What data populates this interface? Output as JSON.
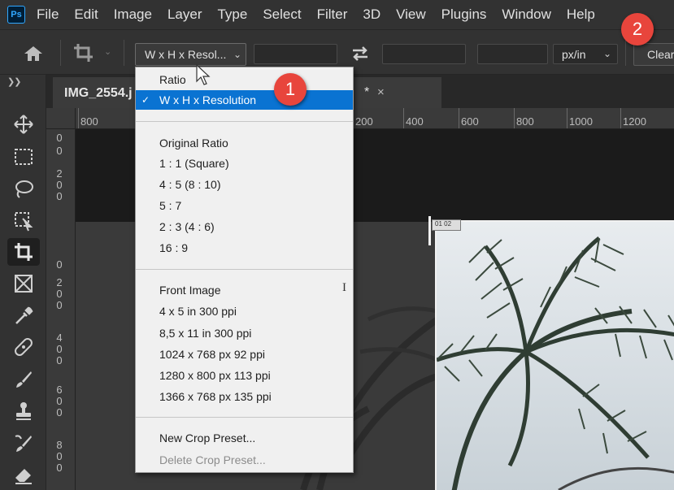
{
  "app": {
    "logo": "Ps"
  },
  "menubar": [
    "File",
    "Edit",
    "Image",
    "Layer",
    "Type",
    "Select",
    "Filter",
    "3D",
    "View",
    "Plugins",
    "Window",
    "Help"
  ],
  "options": {
    "ratio_select": "W x H x Resol...",
    "unit_select": "px/in",
    "clear": "Clear"
  },
  "document": {
    "tab_title": "IMG_2554.j",
    "modified_marker": "*",
    "close": "×"
  },
  "ruler_h": [
    "800",
    "200",
    "400",
    "600",
    "800",
    "1000",
    "1200"
  ],
  "ruler_v": [
    "0",
    "0",
    "2 0 0",
    "0",
    "2 0 0",
    "4 0 0",
    "6 0 0",
    "8 0 0"
  ],
  "dropdown": {
    "ratio": "Ratio",
    "selected": "W x H x Resolution",
    "ratio_presets": [
      "Original Ratio",
      "1 : 1 (Square)",
      "4 : 5 (8 : 10)",
      "5 : 7",
      "2 : 3 (4 : 6)",
      "16 : 9"
    ],
    "size_presets": [
      "Front Image",
      "4 x 5 in 300 ppi",
      "8,5 x 11 in 300 ppi",
      "1024 x 768 px 92 ppi",
      "1280 x 800 px 113 ppi",
      "1366 x 768 px 135 ppi"
    ],
    "new_preset": "New Crop Preset...",
    "delete_preset": "Delete Crop Preset..."
  },
  "crop_badge": "01 02",
  "badges": {
    "one": "1",
    "two": "2"
  },
  "colors": {
    "accent_selected": "#0a73d2",
    "badge": "#e8453c",
    "ps_blue": "#31a8ff"
  },
  "icons": [
    "home-icon",
    "crop-icon",
    "swap-icon",
    "move-icon",
    "marquee-icon",
    "lasso-icon",
    "object-select-icon",
    "crop-tool-icon",
    "frame-icon",
    "eyedropper-icon",
    "healing-icon",
    "brush-icon",
    "stamp-icon",
    "history-brush-icon",
    "eraser-icon"
  ]
}
